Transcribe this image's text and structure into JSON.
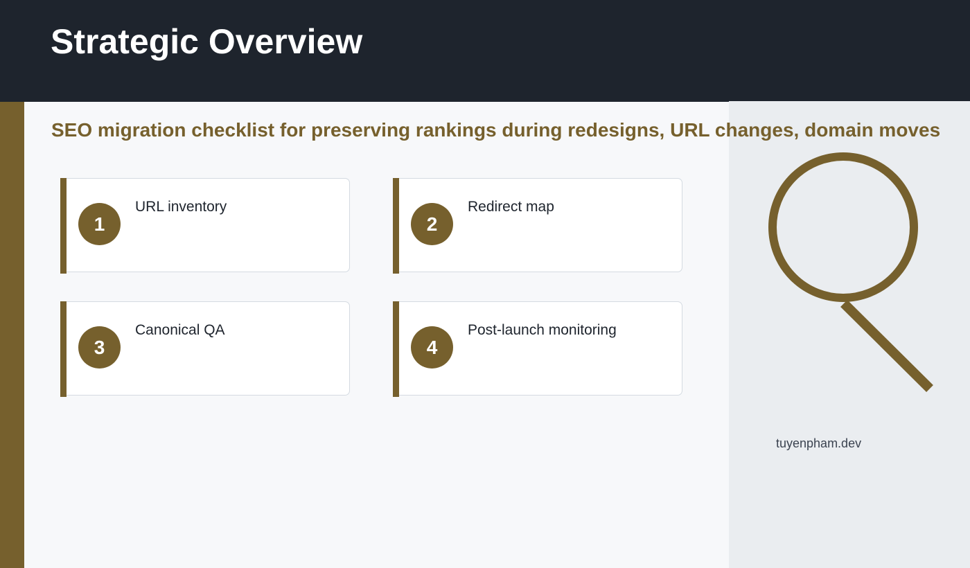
{
  "header": {
    "title": "Strategic Overview"
  },
  "subtitle": "SEO migration checklist for preserving rankings during redesigns, URL changes, domain moves",
  "steps": [
    {
      "number": "1",
      "label": "URL inventory"
    },
    {
      "number": "2",
      "label": "Redirect map"
    },
    {
      "number": "3",
      "label": "Canonical QA"
    },
    {
      "number": "4",
      "label": "Post-launch monitoring"
    }
  ],
  "side_panel": {
    "icon": "magnifying-glass-icon",
    "credit": "tuyenpham.dev"
  },
  "colors": {
    "accent": "#76602d",
    "header_bg": "#1e242d",
    "main_bg": "#f7f8fa",
    "side_bg": "#eaedf0"
  }
}
